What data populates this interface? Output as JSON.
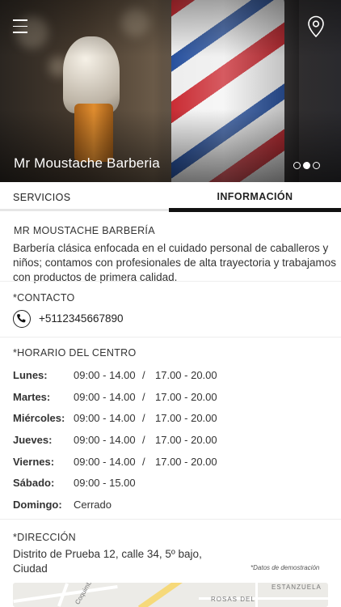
{
  "hero": {
    "title": "Mr Moustache Barberia",
    "slides": [
      false,
      true,
      false
    ]
  },
  "tabs": {
    "servicios": "SERVICIOS",
    "informacion": "INFORMACIÓN"
  },
  "business": {
    "name": "MR MOUSTACHE BARBERÍA",
    "description": "Barbería clásica enfocada en el cuidado personal de caballeros y niños; contamos con profesionales de alta trayectoria y trabajamos con  productos de primera calidad."
  },
  "contact": {
    "label": "*CONTACTO",
    "phone": "+5112345667890"
  },
  "schedule": {
    "label": "*HORARIO DEL CENTRO",
    "separator": "/",
    "rows": [
      {
        "day": "Lunes:",
        "slot1": "09:00 - 14.00",
        "slot2": "17.00 - 20.00"
      },
      {
        "day": "Martes:",
        "slot1": "09:00 - 14.00",
        "slot2": "17.00 - 20.00"
      },
      {
        "day": "Miércoles:",
        "slot1": "09:00 - 14.00",
        "slot2": "17.00 - 20.00"
      },
      {
        "day": "Jueves:",
        "slot1": "09:00 - 14.00",
        "slot2": "17.00 - 20.00"
      },
      {
        "day": "Viernes:",
        "slot1": "09:00 - 14.00",
        "slot2": "17.00 - 20.00"
      },
      {
        "day": "Sábado:",
        "slot1": "09:00 - 15.00",
        "slot2": ""
      },
      {
        "day": "Domingo:",
        "slot1": "Cerrado",
        "slot2": ""
      }
    ]
  },
  "address": {
    "label": "*DIRECCIÓN",
    "line1": "Distrito de Prueba 12, calle 34, 5º bajo,",
    "line2": "Ciudad",
    "demo_note": "*Datos de demostración"
  },
  "map": {
    "labels": [
      "ESTANZUELA",
      "ROSAS DEL",
      "Coquimbo"
    ]
  },
  "icons": {
    "menu": "hamburger-menu-icon",
    "location": "map-pin-icon",
    "phone": "phone-icon"
  }
}
